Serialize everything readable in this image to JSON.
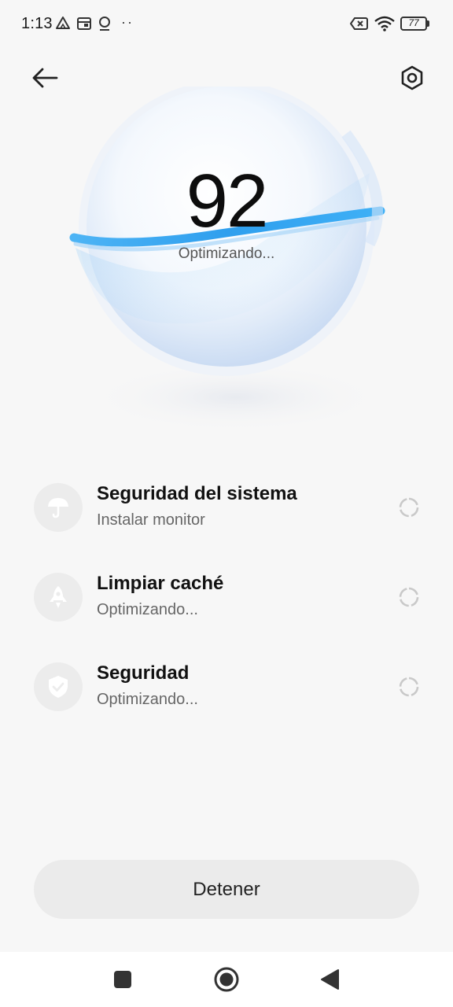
{
  "status_bar": {
    "time": "1:13",
    "battery": "77",
    "icons": [
      "drive-icon",
      "calendar-icon",
      "location-icon",
      "more-dots-icon",
      "no-sim-icon",
      "wifi-icon",
      "battery-icon"
    ]
  },
  "header": {
    "back_icon": "back-arrow-icon",
    "settings_icon": "settings-hexagon-icon"
  },
  "hero": {
    "score": "92",
    "status": "Optimizando..."
  },
  "tasks": [
    {
      "title": "Seguridad del sistema",
      "subtitle": "Instalar monitor",
      "icon": "umbrella-icon"
    },
    {
      "title": "Limpiar caché",
      "subtitle": "Optimizando...",
      "icon": "rocket-icon"
    },
    {
      "title": "Seguridad",
      "subtitle": "Optimizando...",
      "icon": "shield-check-icon"
    }
  ],
  "stop_button": {
    "label": "Detener"
  },
  "nav_bar": {
    "icons": [
      "recents-square-icon",
      "home-circle-icon",
      "back-triangle-icon"
    ]
  },
  "colors": {
    "accent_ring": "#3aa8f2",
    "background": "#f7f7f7",
    "button_bg": "#ebebeb"
  }
}
